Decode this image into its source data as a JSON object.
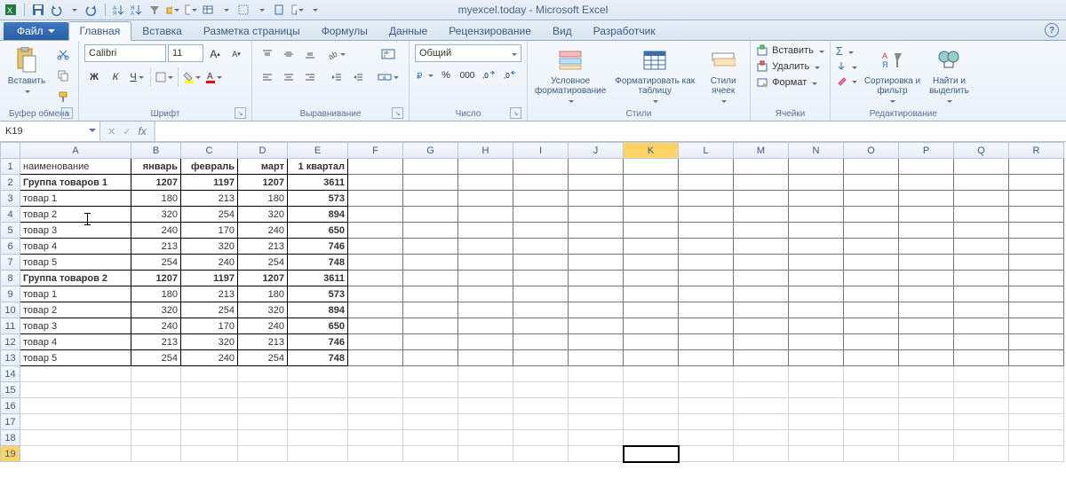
{
  "title": "myexcel.today - Microsoft Excel",
  "tabs": {
    "file": "Файл",
    "items": [
      "Главная",
      "Вставка",
      "Разметка страницы",
      "Формулы",
      "Данные",
      "Рецензирование",
      "Вид",
      "Разработчик"
    ],
    "active_index": 0
  },
  "ribbon": {
    "clipboard": {
      "label": "Буфер обмена",
      "paste": "Вставить"
    },
    "font": {
      "label": "Шрифт",
      "name": "Calibri",
      "size": "11",
      "bold": "Ж",
      "italic": "К",
      "underline": "Ч"
    },
    "alignment": {
      "label": "Выравнивание"
    },
    "number": {
      "label": "Число",
      "format": "Общий"
    },
    "styles": {
      "label": "Стили",
      "cond_fmt": "Условное форматирование",
      "as_table": "Форматировать как таблицу",
      "cell_styles": "Стили ячеек"
    },
    "cells": {
      "label": "Ячейки",
      "insert": "Вставить",
      "delete": "Удалить",
      "format": "Формат"
    },
    "editing": {
      "label": "Редактирование",
      "sort": "Сортировка и фильтр",
      "find": "Найти и выделить"
    }
  },
  "name_box": "K19",
  "formula_value": "",
  "columns": [
    "A",
    "B",
    "C",
    "D",
    "E",
    "F",
    "G",
    "H",
    "I",
    "J",
    "K",
    "L",
    "M",
    "N",
    "O",
    "P",
    "Q",
    "R"
  ],
  "selected_column": "K",
  "selected_row": 19,
  "active_cell": "K19",
  "data_last_col": "E",
  "sheet_rows": [
    {
      "r": 1,
      "A": "наименование",
      "B": "январь",
      "C": "февраль",
      "D": "март",
      "E": "1 квартал",
      "bold": true,
      "header": true
    },
    {
      "r": 2,
      "A": "Группа товаров 1",
      "B": 1207,
      "C": 1197,
      "D": 1207,
      "E": 3611,
      "bold": true
    },
    {
      "r": 3,
      "A": "товар 1",
      "B": 180,
      "C": 213,
      "D": 180,
      "E": 573
    },
    {
      "r": 4,
      "A": "товар 2",
      "B": 320,
      "C": 254,
      "D": 320,
      "E": 894
    },
    {
      "r": 5,
      "A": "товар 3",
      "B": 240,
      "C": 170,
      "D": 240,
      "E": 650
    },
    {
      "r": 6,
      "A": "товар 4",
      "B": 213,
      "C": 320,
      "D": 213,
      "E": 746
    },
    {
      "r": 7,
      "A": "товар 5",
      "B": 254,
      "C": 240,
      "D": 254,
      "E": 748
    },
    {
      "r": 8,
      "A": "Группа товаров 2",
      "B": 1207,
      "C": 1197,
      "D": 1207,
      "E": 3611,
      "bold": true
    },
    {
      "r": 9,
      "A": "товар 1",
      "B": 180,
      "C": 213,
      "D": 180,
      "E": 573
    },
    {
      "r": 10,
      "A": "товар 2",
      "B": 320,
      "C": 254,
      "D": 320,
      "E": 894
    },
    {
      "r": 11,
      "A": "товар 3",
      "B": 240,
      "C": 170,
      "D": 240,
      "E": 650
    },
    {
      "r": 12,
      "A": "товар 4",
      "B": 213,
      "C": 320,
      "D": 213,
      "E": 746
    },
    {
      "r": 13,
      "A": "товар 5",
      "B": 254,
      "C": 240,
      "D": 254,
      "E": 748
    }
  ],
  "empty_rows": [
    14,
    15,
    16,
    17,
    18,
    19
  ]
}
